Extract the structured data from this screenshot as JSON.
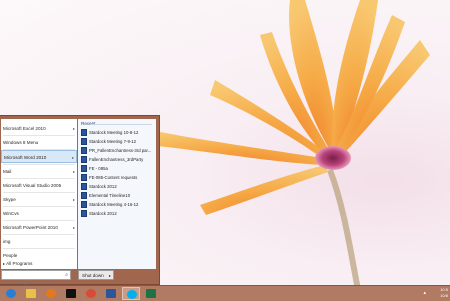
{
  "start_menu": {
    "left_items": [
      {
        "label": "Microsoft Excel 2010",
        "has_arrow": true
      },
      {
        "label": "Windows 8 Menu",
        "has_arrow": false
      },
      {
        "label": "Microsoft Word 2010",
        "has_arrow": true,
        "selected": true
      },
      {
        "label": "Mail",
        "has_arrow": true
      },
      {
        "label": "Microsoft Visual Studio 2005",
        "has_arrow": false
      },
      {
        "label": "Skype",
        "has_arrow": true
      },
      {
        "label": "WinCvs",
        "has_arrow": false
      },
      {
        "label": "Microsoft PowerPoint 2010",
        "has_arrow": true
      },
      {
        "label": "img",
        "has_arrow": false
      },
      {
        "label": "People",
        "has_arrow": false
      }
    ],
    "all_programs_label": "All Programs",
    "search": {
      "placeholder": "Search programs and files"
    },
    "shutdown_label": "Shut down",
    "recent": {
      "header": "Recent",
      "items": [
        "Stardock Meeting 10-8-12",
        "Stardock Meeting 7-9-12",
        "PR_FallenEnchantress-3rd par...",
        "FallenEnchantress_3rdParty",
        "FE - 085a",
        "FE-085-Content requests",
        "Stardock 2012",
        "Elemental Timeline10",
        "Stardock Meeting 4-16-12",
        "Stardock 2012"
      ]
    }
  },
  "taskbar": {
    "buttons": [
      {
        "icon": "internet-explorer-icon",
        "color": "#2a7fd4"
      },
      {
        "icon": "file-explorer-icon",
        "color": "#e8c04a"
      },
      {
        "icon": "firefox-icon",
        "color": "#e5771e"
      },
      {
        "icon": "command-prompt-icon",
        "color": "#111111"
      },
      {
        "icon": "chrome-icon",
        "color": "#d94a38"
      },
      {
        "icon": "word-icon",
        "color": "#2b579a"
      },
      {
        "icon": "skype-icon",
        "color": "#00aff0"
      },
      {
        "icon": "excel-icon",
        "color": "#1f7244"
      }
    ],
    "clock": {
      "time": "10:5",
      "date": "10/8"
    }
  },
  "colors": {
    "menu_frame": "#a0664e",
    "taskbar": "#b07a63"
  }
}
